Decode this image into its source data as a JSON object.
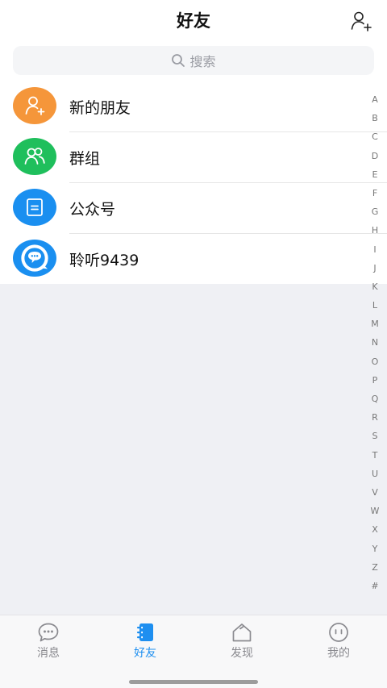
{
  "header": {
    "title": "好友"
  },
  "search": {
    "placeholder": "搜索"
  },
  "entries": [
    {
      "label": "新的朋友",
      "icon": "add-friend-icon",
      "color": "#f5963a"
    },
    {
      "label": "群组",
      "icon": "group-icon",
      "color": "#1fbf5c"
    },
    {
      "label": "公众号",
      "icon": "official-account-icon",
      "color": "#1a8ff0"
    },
    {
      "label": "聆听9439",
      "icon": "chat-bubble-avatar",
      "color": "#1a8ff0"
    }
  ],
  "index_letters": [
    "A",
    "B",
    "C",
    "D",
    "E",
    "F",
    "G",
    "H",
    "I",
    "J",
    "K",
    "L",
    "M",
    "N",
    "O",
    "P",
    "Q",
    "R",
    "S",
    "T",
    "U",
    "V",
    "W",
    "X",
    "Y",
    "Z",
    "#"
  ],
  "tabs": [
    {
      "label": "消息",
      "icon": "message-icon",
      "active": false
    },
    {
      "label": "好友",
      "icon": "contacts-icon",
      "active": true
    },
    {
      "label": "发现",
      "icon": "discover-icon",
      "active": false
    },
    {
      "label": "我的",
      "icon": "profile-icon",
      "active": false
    }
  ],
  "colors": {
    "accent": "#1e8ff0",
    "tab_inactive": "#8a8a8f",
    "background": "#eff0f4"
  }
}
